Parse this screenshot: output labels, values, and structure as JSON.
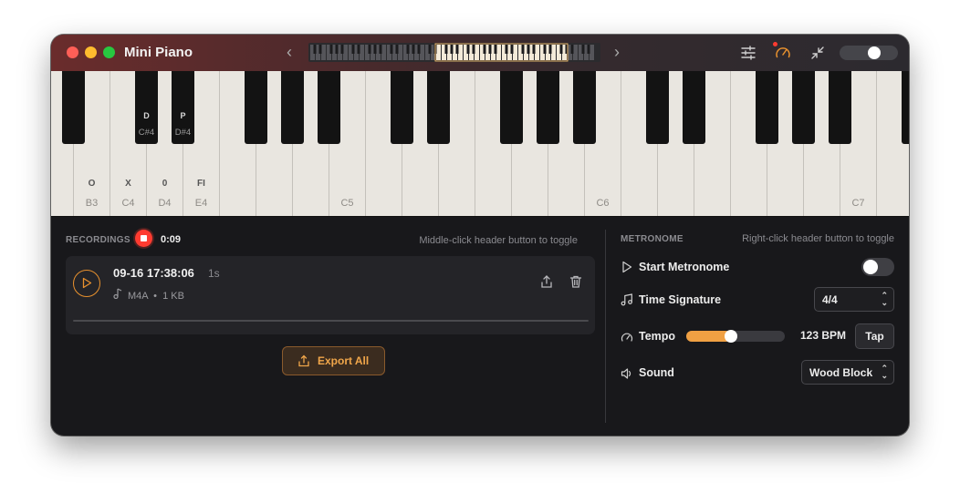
{
  "window": {
    "title": "Mini Piano"
  },
  "toolbar": {
    "icons": [
      "chevron-left-icon",
      "chevron-right-icon",
      "sliders-icon",
      "metronome-gauge-icon",
      "collapse-icon"
    ],
    "accent": "#e8912e"
  },
  "keyboard": {
    "white_keys": [
      {
        "letter": "",
        "note": ""
      },
      {
        "letter": "O",
        "note": "B3"
      },
      {
        "letter": "X",
        "note": "C4"
      },
      {
        "letter": "0",
        "note": "D4"
      },
      {
        "letter": "FI",
        "note": "E4"
      },
      {
        "letter": "",
        "note": ""
      },
      {
        "letter": "",
        "note": ""
      },
      {
        "letter": "",
        "note": ""
      },
      {
        "letter": "",
        "note": "C5"
      },
      {
        "letter": "",
        "note": ""
      },
      {
        "letter": "",
        "note": ""
      },
      {
        "letter": "",
        "note": ""
      },
      {
        "letter": "",
        "note": ""
      },
      {
        "letter": "",
        "note": ""
      },
      {
        "letter": "",
        "note": ""
      },
      {
        "letter": "",
        "note": "C6"
      },
      {
        "letter": "",
        "note": ""
      },
      {
        "letter": "",
        "note": ""
      },
      {
        "letter": "",
        "note": ""
      },
      {
        "letter": "",
        "note": ""
      },
      {
        "letter": "",
        "note": ""
      },
      {
        "letter": "",
        "note": ""
      },
      {
        "letter": "",
        "note": "C7"
      },
      {
        "letter": "",
        "note": ""
      }
    ],
    "black_keys": [
      {
        "letter": "D",
        "note": "C#4"
      },
      {
        "letter": "P",
        "note": "D#4"
      }
    ]
  },
  "recordings": {
    "label": "RECORDINGS",
    "elapsed": "0:09",
    "hint": "Middle-click header button to toggle",
    "items": [
      {
        "title": "09-16 17:38:06",
        "duration": "1s",
        "format": "M4A",
        "size": "1 KB",
        "progress": 0
      }
    ],
    "export_label": "Export All"
  },
  "metronome": {
    "label": "METRONOME",
    "hint": "Right-click header button to toggle",
    "start_label": "Start Metronome",
    "running": false,
    "time_signature_label": "Time Signature",
    "time_signature": "4/4",
    "tempo_label": "Tempo",
    "tempo_fraction": 0.4,
    "bpm_text": "123 BPM",
    "tap_label": "Tap",
    "sound_label": "Sound",
    "sound": "Wood Block"
  }
}
